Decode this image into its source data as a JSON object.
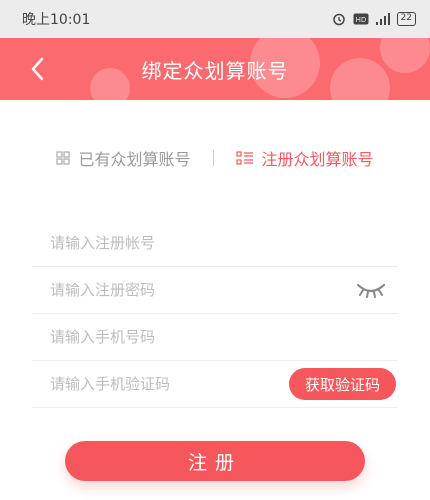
{
  "status_bar": {
    "time": "晚上10:01",
    "battery": "22"
  },
  "header": {
    "title": "绑定众划算账号"
  },
  "tabs": [
    {
      "label": "已有众划算账号",
      "active": false
    },
    {
      "label": "注册众划算账号",
      "active": true
    }
  ],
  "form": {
    "account_placeholder": "请输入注册帐号",
    "password_placeholder": "请输入注册密码",
    "phone_placeholder": "请输入手机号码",
    "code_placeholder": "请输入手机验证码",
    "get_code_label": "获取验证码"
  },
  "register_label": "注册",
  "colors": {
    "header": "#fb6a6f",
    "accent": "#f5575c",
    "active_tab": "#f05a5f",
    "inactive_tab": "#9a9a9a"
  },
  "icons": {
    "back": "chevron-left-icon",
    "existing_tab": "grid-icon",
    "register_tab": "list-icon",
    "password_toggle": "closed-eye-icon"
  }
}
